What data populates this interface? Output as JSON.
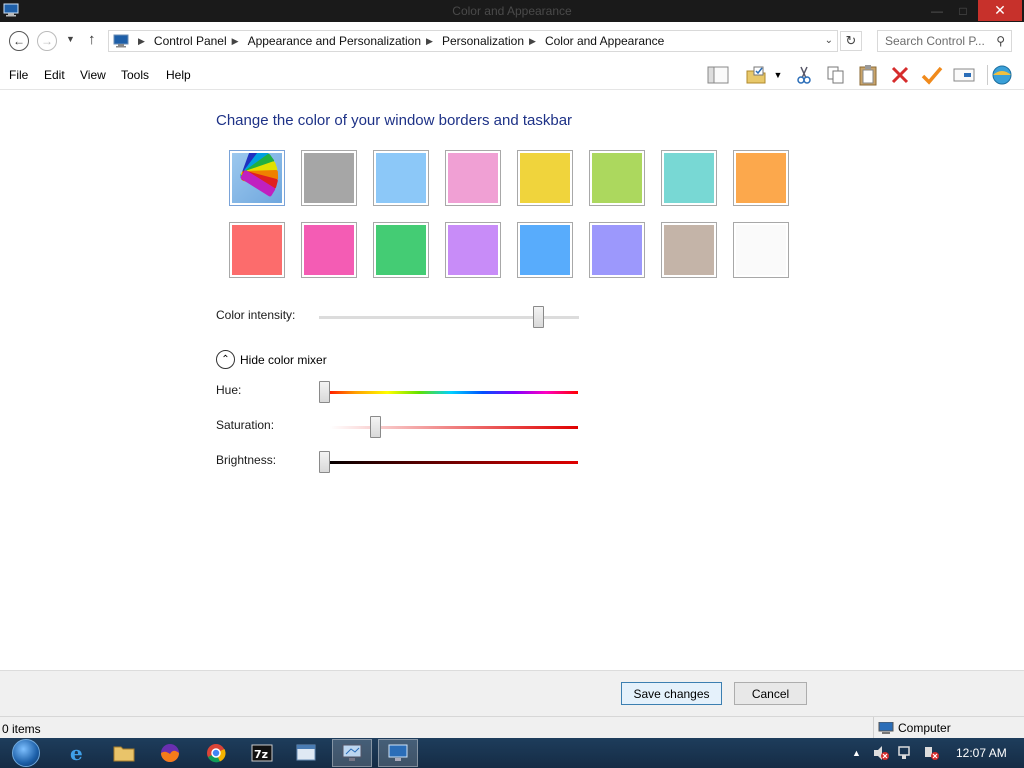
{
  "window": {
    "title": "Color and Appearance"
  },
  "nav": {
    "breadcrumbs": [
      "Control Panel",
      "Appearance and Personalization",
      "Personalization",
      "Color and Appearance"
    ],
    "search_placeholder": "Search Control P..."
  },
  "menu": {
    "items": [
      "File",
      "Edit",
      "View",
      "Tools",
      "Help"
    ]
  },
  "toolbar": {
    "icons": [
      "layout-icon",
      "properties-icon",
      "cut-icon",
      "copy-icon",
      "paste-icon",
      "delete-icon",
      "checkmark-icon",
      "rename-icon",
      "internet-options-icon"
    ]
  },
  "content": {
    "heading": "Change the color of your window borders and taskbar",
    "swatches": [
      {
        "name": "automatic",
        "color": "#6fa7de",
        "selected": true
      },
      {
        "name": "gray",
        "color": "#a6a6a6"
      },
      {
        "name": "sky",
        "color": "#8cc8f8"
      },
      {
        "name": "pink",
        "color": "#f0a0d4"
      },
      {
        "name": "yellow",
        "color": "#f0d43c"
      },
      {
        "name": "lime",
        "color": "#acd85e"
      },
      {
        "name": "teal",
        "color": "#78d8d4"
      },
      {
        "name": "orange",
        "color": "#fca84c"
      },
      {
        "name": "red",
        "color": "#fc6c6c"
      },
      {
        "name": "magenta",
        "color": "#f45cb4"
      },
      {
        "name": "green",
        "color": "#44cc74"
      },
      {
        "name": "purple",
        "color": "#c88cf8"
      },
      {
        "name": "blue",
        "color": "#58acfc"
      },
      {
        "name": "lavender",
        "color": "#9c98fc"
      },
      {
        "name": "taupe",
        "color": "#c4b4a8"
      },
      {
        "name": "white",
        "color": "#fafafa"
      }
    ],
    "intensity_label": "Color intensity:",
    "intensity_value": 0.86,
    "mixer_toggle_label": "Hide color mixer",
    "hue_label": "Hue:",
    "hue_value": 0.0,
    "saturation_label": "Saturation:",
    "saturation_value": 0.18,
    "brightness_label": "Brightness:",
    "brightness_value": 0.0
  },
  "footer": {
    "save_label": "Save changes",
    "cancel_label": "Cancel"
  },
  "status": {
    "items_count": "0 items",
    "location": "Computer"
  },
  "taskbar": {
    "apps": [
      "internet-explorer-icon",
      "file-explorer-icon",
      "firefox-icon",
      "chrome-icon",
      "7zip-icon",
      "window-app-icon",
      "display-settings-icon",
      "control-panel-icon"
    ],
    "time": "12:07 AM"
  }
}
